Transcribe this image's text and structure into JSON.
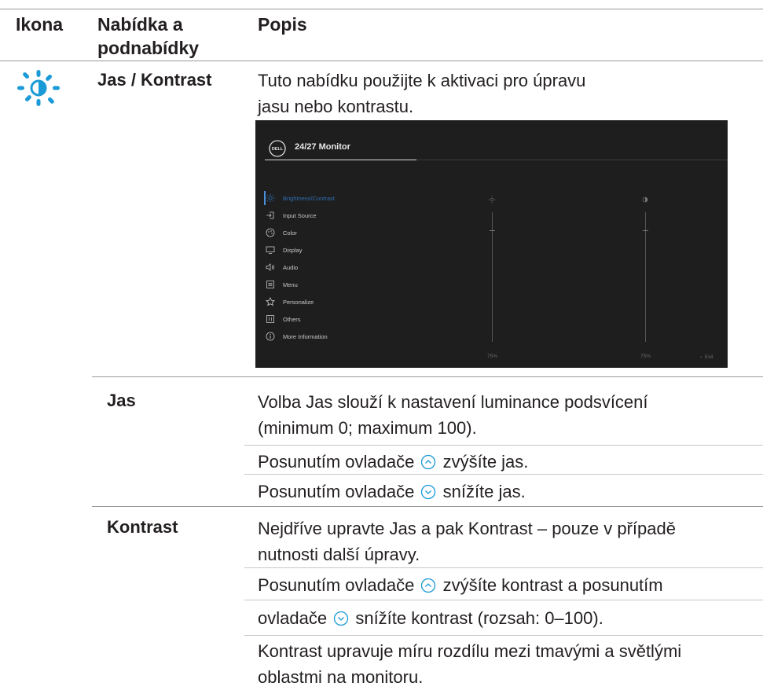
{
  "header": {
    "col_icon": "Ikona",
    "col_menu": "Nabídka a podnabídky",
    "col_desc": "Popis"
  },
  "row_main": {
    "icon": "brightness-contrast-icon",
    "label": "Jas / Kontrast",
    "desc": "Tuto nabídku použijte k aktivaci pro úpravu jasu nebo kontrastu."
  },
  "osd": {
    "title": "24/27 Monitor",
    "menu": [
      {
        "label": "Brightness/Contrast",
        "icon": "brightness-icon",
        "active": true
      },
      {
        "label": "Input Source",
        "icon": "input-source-icon"
      },
      {
        "label": "Color",
        "icon": "color-icon"
      },
      {
        "label": "Display",
        "icon": "display-icon"
      },
      {
        "label": "Audio",
        "icon": "audio-icon"
      },
      {
        "label": "Menu",
        "icon": "menu-icon"
      },
      {
        "label": "Personalize",
        "icon": "star-icon"
      },
      {
        "label": "Others",
        "icon": "others-icon"
      },
      {
        "label": "More Information",
        "icon": "info-icon"
      }
    ],
    "brightness_value": "75%",
    "contrast_value": "75%",
    "brightness_level": 75,
    "contrast_level": 75,
    "exit_label": "Exit",
    "accent": "#2f6fb3"
  },
  "row_jas": {
    "label": "Jas",
    "desc1": "Volba Jas slouží k nastavení luminance podsvícení (minimum 0; maximum 100).",
    "desc2_pre": "Posunutím ovladače",
    "desc2_post": "zvýšíte jas.",
    "desc3_pre": "Posunutím ovladače",
    "desc3_post": "snížíte jas."
  },
  "row_kontrast": {
    "label": "Kontrast",
    "desc1": "Nejdříve upravte Jas a pak Kontrast – pouze v případě nutnosti další úpravy.",
    "desc2_pre": "Posunutím ovladače",
    "desc2_post": "zvýšíte kontrast a posunutím",
    "desc3_pre": "ovladače",
    "desc3_post": "snížíte kontrast (rozsah: 0–100).",
    "desc4": "Kontrast upravuje míru rozdílu mezi tmavými a světlými oblastmi na monitoru."
  },
  "colors": {
    "icon_blue": "#1a9ad6",
    "rule": "#9a9a9a"
  }
}
